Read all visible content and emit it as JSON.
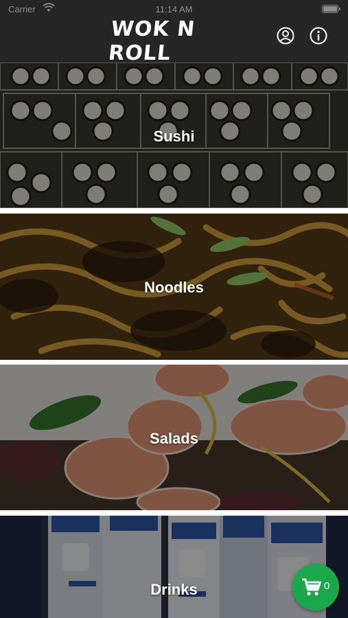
{
  "status_bar": {
    "carrier": "Carrier",
    "time": "11:14 AM"
  },
  "nav": {
    "brand": "WOK N ROLL",
    "icons": [
      "account-icon",
      "info-icon"
    ]
  },
  "categories": [
    {
      "label": "Sushi"
    },
    {
      "label": "Noodles"
    },
    {
      "label": "Salads"
    },
    {
      "label": "Drinks"
    }
  ],
  "cart": {
    "count": "0",
    "icon": "shopping-cart-icon"
  },
  "colors": {
    "nav_bg": "#262626",
    "cart_bg": "#1ba84a",
    "text": "#ffffff"
  }
}
